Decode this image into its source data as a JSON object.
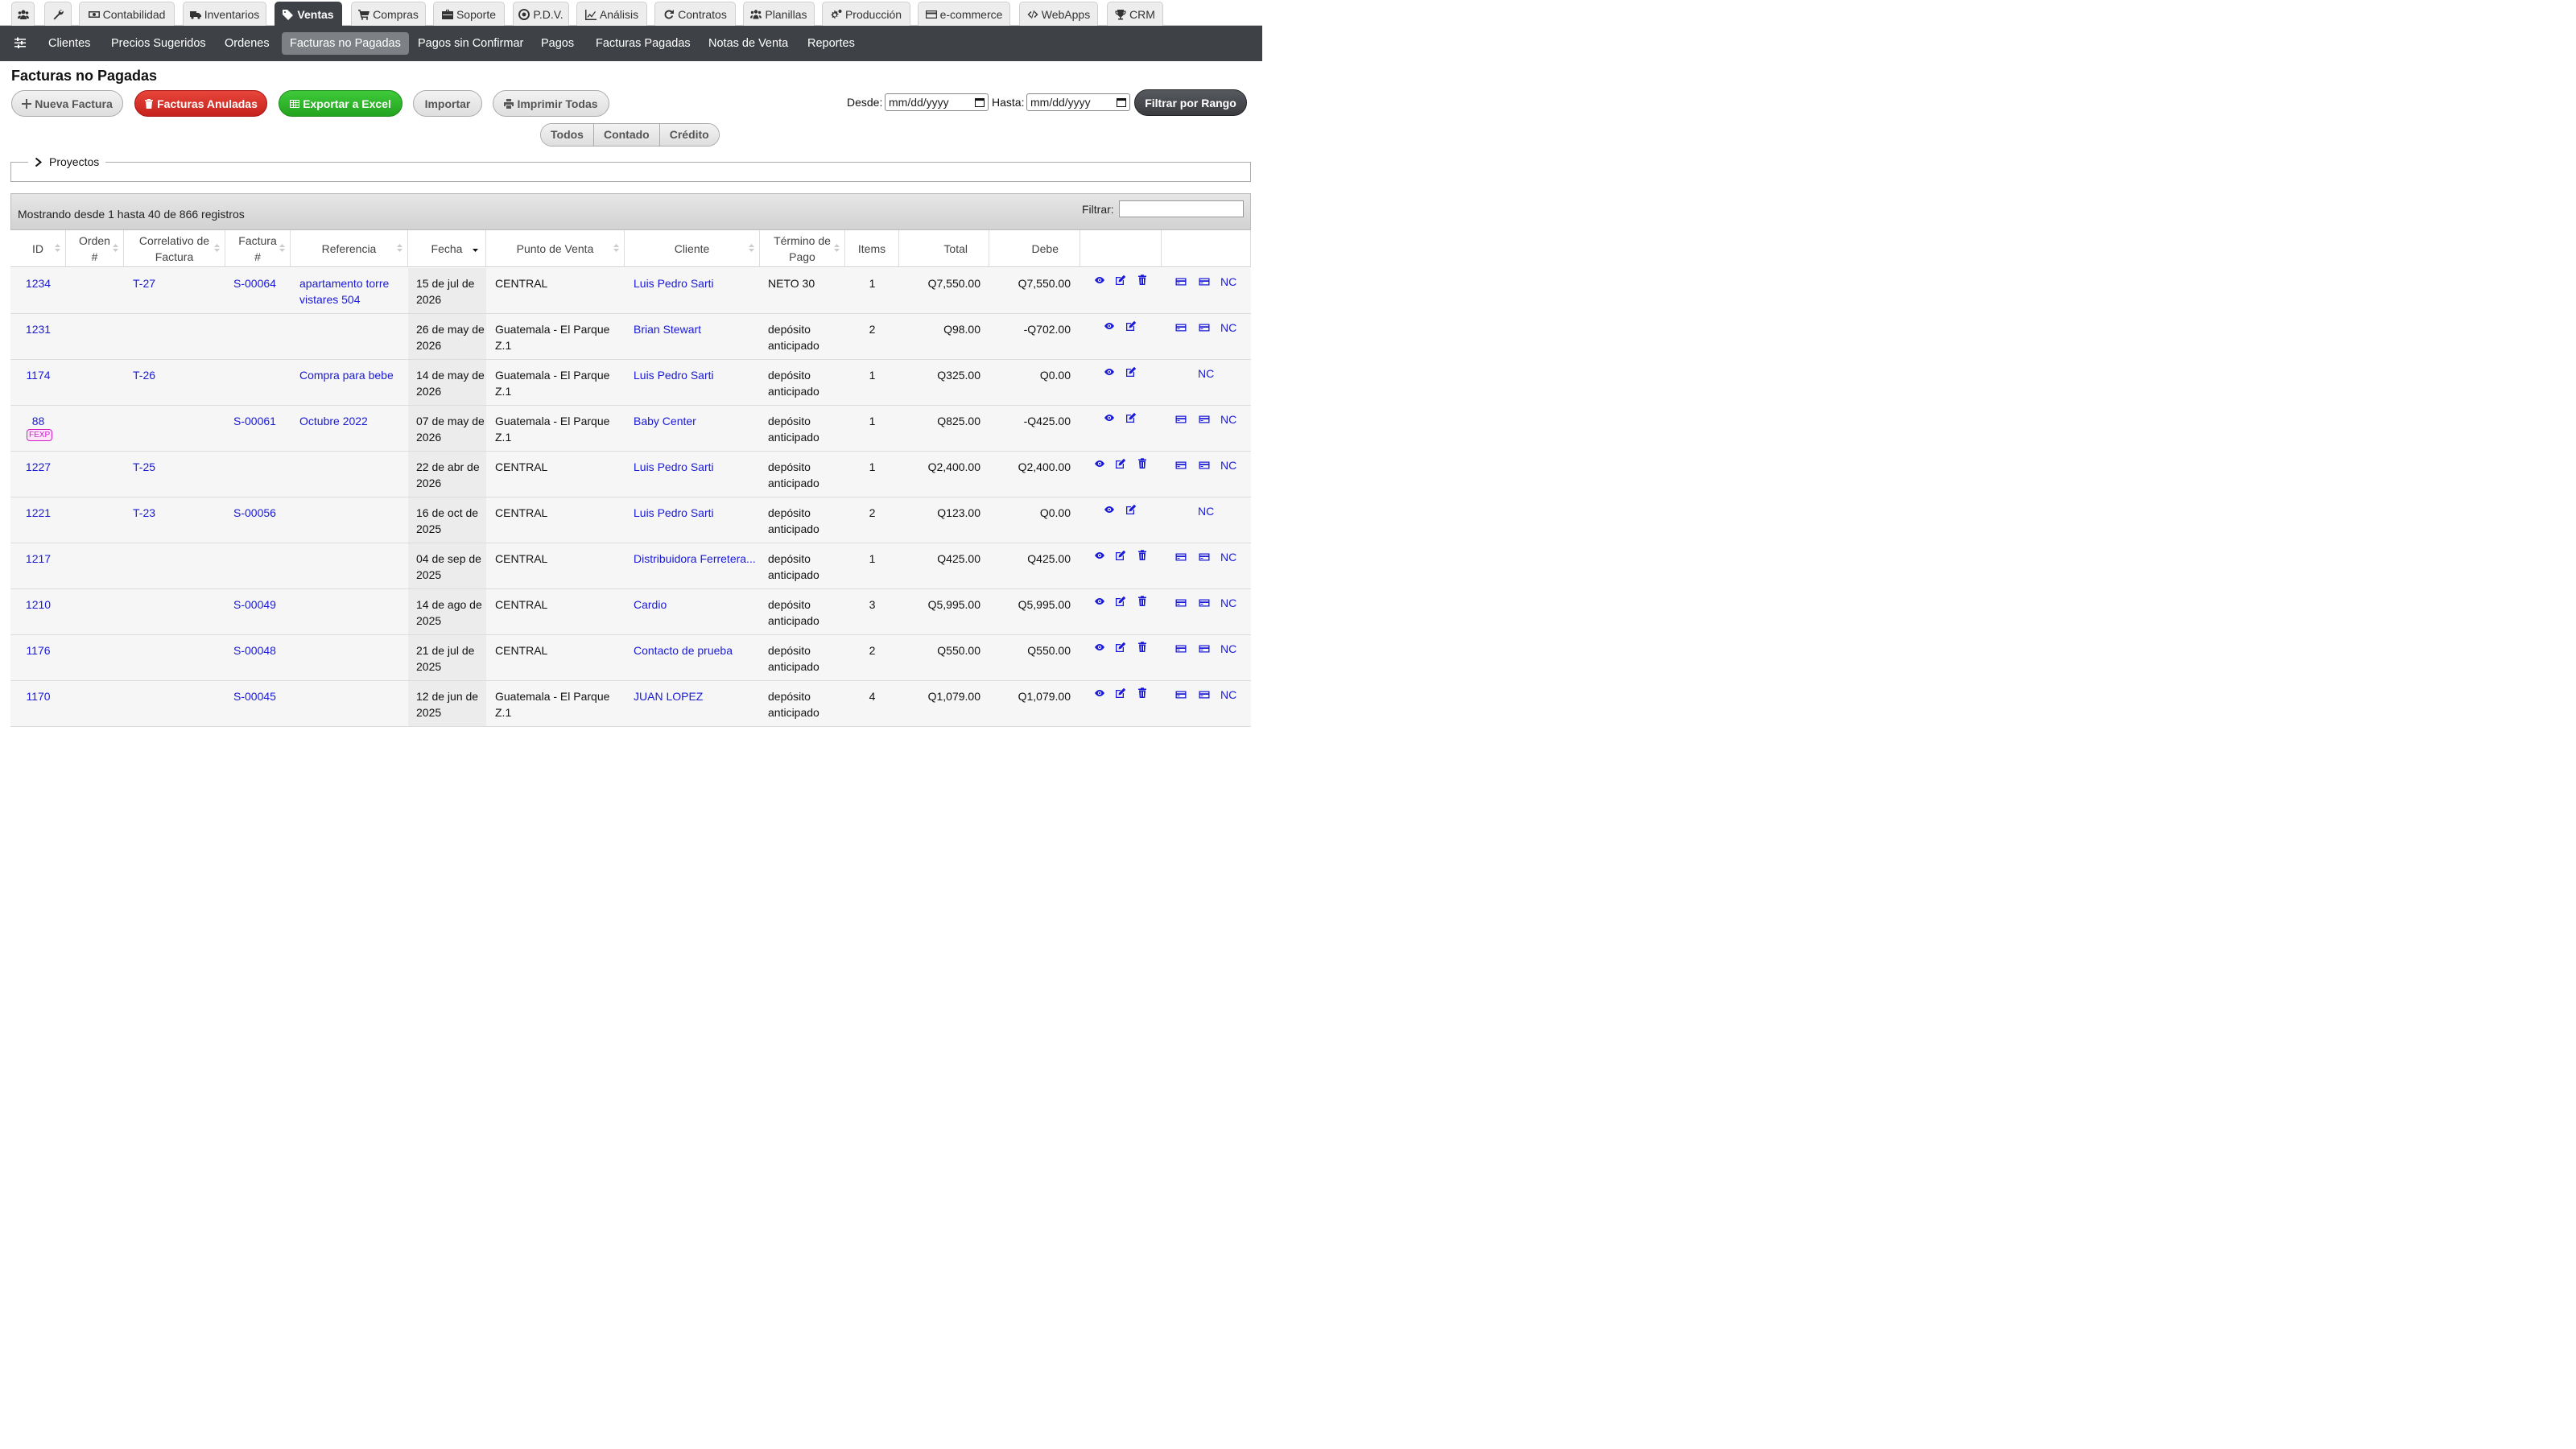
{
  "top_tabs": [
    {
      "label": "",
      "icon": "users-icon"
    },
    {
      "label": "",
      "icon": "wrench-icon"
    },
    {
      "label": "Contabilidad",
      "icon": "money-icon"
    },
    {
      "label": "Inventarios",
      "icon": "truck-icon"
    },
    {
      "label": "Ventas",
      "icon": "tag-icon"
    },
    {
      "label": "Compras",
      "icon": "cart-icon"
    },
    {
      "label": "Soporte",
      "icon": "briefcase-icon"
    },
    {
      "label": "P.D.V.",
      "icon": "target-icon"
    },
    {
      "label": "Análisis",
      "icon": "chart-icon"
    },
    {
      "label": "Contratos",
      "icon": "refresh-icon"
    },
    {
      "label": "Planillas",
      "icon": "group-icon"
    },
    {
      "label": "Producción",
      "icon": "cogs-icon"
    },
    {
      "label": "e-commerce",
      "icon": "card-icon"
    },
    {
      "label": "WebApps",
      "icon": "code-icon"
    },
    {
      "label": "CRM",
      "icon": "trophy-icon"
    }
  ],
  "active_top_tab": "Ventas",
  "sub_nav": [
    "Clientes",
    "Precios Sugeridos",
    "Ordenes",
    "Facturas no Pagadas",
    "Pagos sin Confirmar",
    "Pagos",
    "Facturas Pagadas",
    "Notas de Venta",
    "Reportes"
  ],
  "active_sub_nav": "Facturas no Pagadas",
  "page_title": "Facturas no Pagadas",
  "toolbar": {
    "nueva": "Nueva Factura",
    "anuladas": "Facturas Anuladas",
    "exportar": "Exportar a Excel",
    "importar": "Importar",
    "imprimir": "Imprimir Todas",
    "desde_label": "Desde:",
    "hasta_label": "Hasta:",
    "desde_value": "mm/dd/yyyy",
    "hasta_value": "mm/dd/yyyy",
    "filtrar_rango": "Filtrar por Rango"
  },
  "segments": [
    "Todos",
    "Contado",
    "Crédito"
  ],
  "proyectos_label": "Proyectos",
  "table_info": "Mostrando desde 1 hasta 40 de 866 registros",
  "filter_label": "Filtrar:",
  "filter_value": "",
  "columns": [
    "ID",
    "Orden #",
    "Correlativo de Factura",
    "Factura #",
    "Referencia",
    "Fecha",
    "Punto de Venta",
    "Cliente",
    "Término de Pago",
    "Items",
    "Total",
    "Debe",
    "",
    ""
  ],
  "rows": [
    {
      "id": "1234",
      "badge": "",
      "correlativo": "T-27",
      "factura": "S-00064",
      "referencia": "apartamento torre vistares 504",
      "fecha": "15 de jul de 2026",
      "punto": "CENTRAL",
      "cliente": "Luis Pedro Sarti",
      "termino": "NETO 30",
      "items": "1",
      "total": "Q7,550.00",
      "debe": "Q7,550.00",
      "delete": true,
      "pay": true,
      "nc": "NC"
    },
    {
      "id": "1231",
      "badge": "",
      "correlativo": "",
      "factura": "",
      "referencia": "",
      "fecha": "26 de may de 2026",
      "punto": "Guatemala - El Parque Z.1",
      "cliente": "Brian Stewart",
      "termino": "depósito anticipado",
      "items": "2",
      "total": "Q98.00",
      "debe": "-Q702.00",
      "delete": false,
      "pay": true,
      "nc": "NC"
    },
    {
      "id": "1174",
      "badge": "",
      "correlativo": "T-26",
      "factura": "",
      "referencia": "Compra para bebe",
      "fecha": "14 de may de 2026",
      "punto": "Guatemala - El Parque Z.1",
      "cliente": "Luis Pedro Sarti",
      "termino": "depósito anticipado",
      "items": "1",
      "total": "Q325.00",
      "debe": "Q0.00",
      "delete": false,
      "pay": false,
      "nc": "NC"
    },
    {
      "id": "88",
      "badge": "FEXP",
      "correlativo": "",
      "factura": "S-00061",
      "referencia": "Octubre 2022",
      "fecha": "07 de may de 2026",
      "punto": "Guatemala - El Parque Z.1",
      "cliente": "Baby Center",
      "termino": "depósito anticipado",
      "items": "1",
      "total": "Q825.00",
      "debe": "-Q425.00",
      "delete": false,
      "pay": true,
      "nc": "NC"
    },
    {
      "id": "1227",
      "badge": "",
      "correlativo": "T-25",
      "factura": "",
      "referencia": "",
      "fecha": "22 de abr de 2026",
      "punto": "CENTRAL",
      "cliente": "Luis Pedro Sarti",
      "termino": "depósito anticipado",
      "items": "1",
      "total": "Q2,400.00",
      "debe": "Q2,400.00",
      "delete": true,
      "pay": true,
      "nc": "NC"
    },
    {
      "id": "1221",
      "badge": "",
      "correlativo": "T-23",
      "factura": "S-00056",
      "referencia": "",
      "fecha": "16 de oct de 2025",
      "punto": "CENTRAL",
      "cliente": "Luis Pedro Sarti",
      "termino": "depósito anticipado",
      "items": "2",
      "total": "Q123.00",
      "debe": "Q0.00",
      "delete": false,
      "pay": false,
      "nc": "NC"
    },
    {
      "id": "1217",
      "badge": "",
      "correlativo": "",
      "factura": "",
      "referencia": "",
      "fecha": "04 de sep de 2025",
      "punto": "CENTRAL",
      "cliente": "Distribuidora Ferretera...",
      "termino": "depósito anticipado",
      "items": "1",
      "total": "Q425.00",
      "debe": "Q425.00",
      "delete": true,
      "pay": true,
      "nc": "NC"
    },
    {
      "id": "1210",
      "badge": "",
      "correlativo": "",
      "factura": "S-00049",
      "referencia": "",
      "fecha": "14 de ago de 2025",
      "punto": "CENTRAL",
      "cliente": "Cardio",
      "termino": "depósito anticipado",
      "items": "3",
      "total": "Q5,995.00",
      "debe": "Q5,995.00",
      "delete": true,
      "pay": true,
      "nc": "NC"
    },
    {
      "id": "1176",
      "badge": "",
      "correlativo": "",
      "factura": "S-00048",
      "referencia": "",
      "fecha": "21 de jul de 2025",
      "punto": "CENTRAL",
      "cliente": "Contacto de prueba",
      "termino": "depósito anticipado",
      "items": "2",
      "total": "Q550.00",
      "debe": "Q550.00",
      "delete": true,
      "pay": true,
      "nc": "NC"
    },
    {
      "id": "1170",
      "badge": "",
      "correlativo": "",
      "factura": "S-00045",
      "referencia": "",
      "fecha": "12 de jun de 2025",
      "punto": "Guatemala - El Parque Z.1",
      "cliente": "JUAN LOPEZ",
      "termino": "depósito anticipado",
      "items": "4",
      "total": "Q1,079.00",
      "debe": "Q1,079.00",
      "delete": true,
      "pay": true,
      "nc": "NC"
    }
  ],
  "colors": {
    "link": "#1a1ad6",
    "nav_dark": "#3e4145",
    "badge": "#d41cc9"
  }
}
